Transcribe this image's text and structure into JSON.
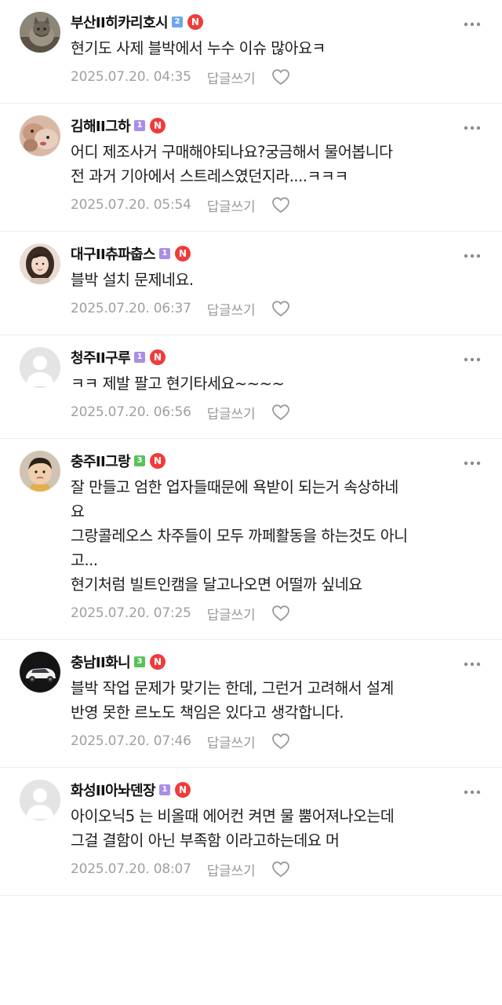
{
  "colors": {
    "n_badge": "#f03b3b",
    "level_1": "#a98ee6",
    "level_2": "#6fa6ea",
    "level_3": "#59c15a",
    "meta_text": "#a0a0a0",
    "divider": "#ececec"
  },
  "reply_label": "답글쓰기",
  "n_badge_label": "N",
  "comments": [
    {
      "nickname": "부산II히카리호시",
      "level": "2",
      "level_color": "#6fa6ea",
      "avatar": "cat-photo",
      "lines": [
        "현기도 사제 블박에서 누수 이슈 많아요ㅋ"
      ],
      "date": "2025.07.20. 04:35"
    },
    {
      "nickname": "김해II그하",
      "level": "1",
      "level_color": "#a98ee6",
      "avatar": "puppies-photo",
      "lines": [
        "어디 제조사거 구매해야되나요?궁금해서 물어봅니다",
        "전 과거 기아에서 스트레스였던지라....ㅋㅋㅋ"
      ],
      "date": "2025.07.20. 05:54"
    },
    {
      "nickname": "대구II츄파춥스",
      "level": "1",
      "level_color": "#a98ee6",
      "avatar": "woman-photo",
      "lines": [
        "블박 설치 문제네요."
      ],
      "date": "2025.07.20. 06:37"
    },
    {
      "nickname": "청주II구루",
      "level": "1",
      "level_color": "#a98ee6",
      "avatar": "default-profile",
      "lines": [
        "ㅋㅋ 제발 팔고 현기타세요~~~~"
      ],
      "date": "2025.07.20. 06:56"
    },
    {
      "nickname": "충주II그랑",
      "level": "3",
      "level_color": "#59c15a",
      "avatar": "child-photo",
      "lines": [
        "잘 만들고 엄한 업자들때문에 욕받이 되는거 속상하네",
        "요",
        "그랑콜레오스 차주들이 모두 까페활동을 하는것도 아니",
        "고...",
        "현기처럼 빌트인캠을 달고나오면 어떨까 싶네요"
      ],
      "date": "2025.07.20. 07:25"
    },
    {
      "nickname": "충남II화니",
      "level": "3",
      "level_color": "#59c15a",
      "avatar": "white-suv-photo",
      "lines": [
        "블박 작업 문제가 맞기는 한데, 그런거 고려해서 설계",
        "반영 못한 르노도 책임은 있다고 생각합니다."
      ],
      "date": "2025.07.20. 07:46"
    },
    {
      "nickname": "화성II아놔덴장",
      "level": "1",
      "level_color": "#a98ee6",
      "avatar": "default-profile",
      "lines": [
        "아이오닉5 는 비올때 에어컨 켜면 물 뿜어져나오는데",
        "그걸 결함이 아닌 부족함 이라고하는데요 머"
      ],
      "date": "2025.07.20. 08:07"
    }
  ]
}
